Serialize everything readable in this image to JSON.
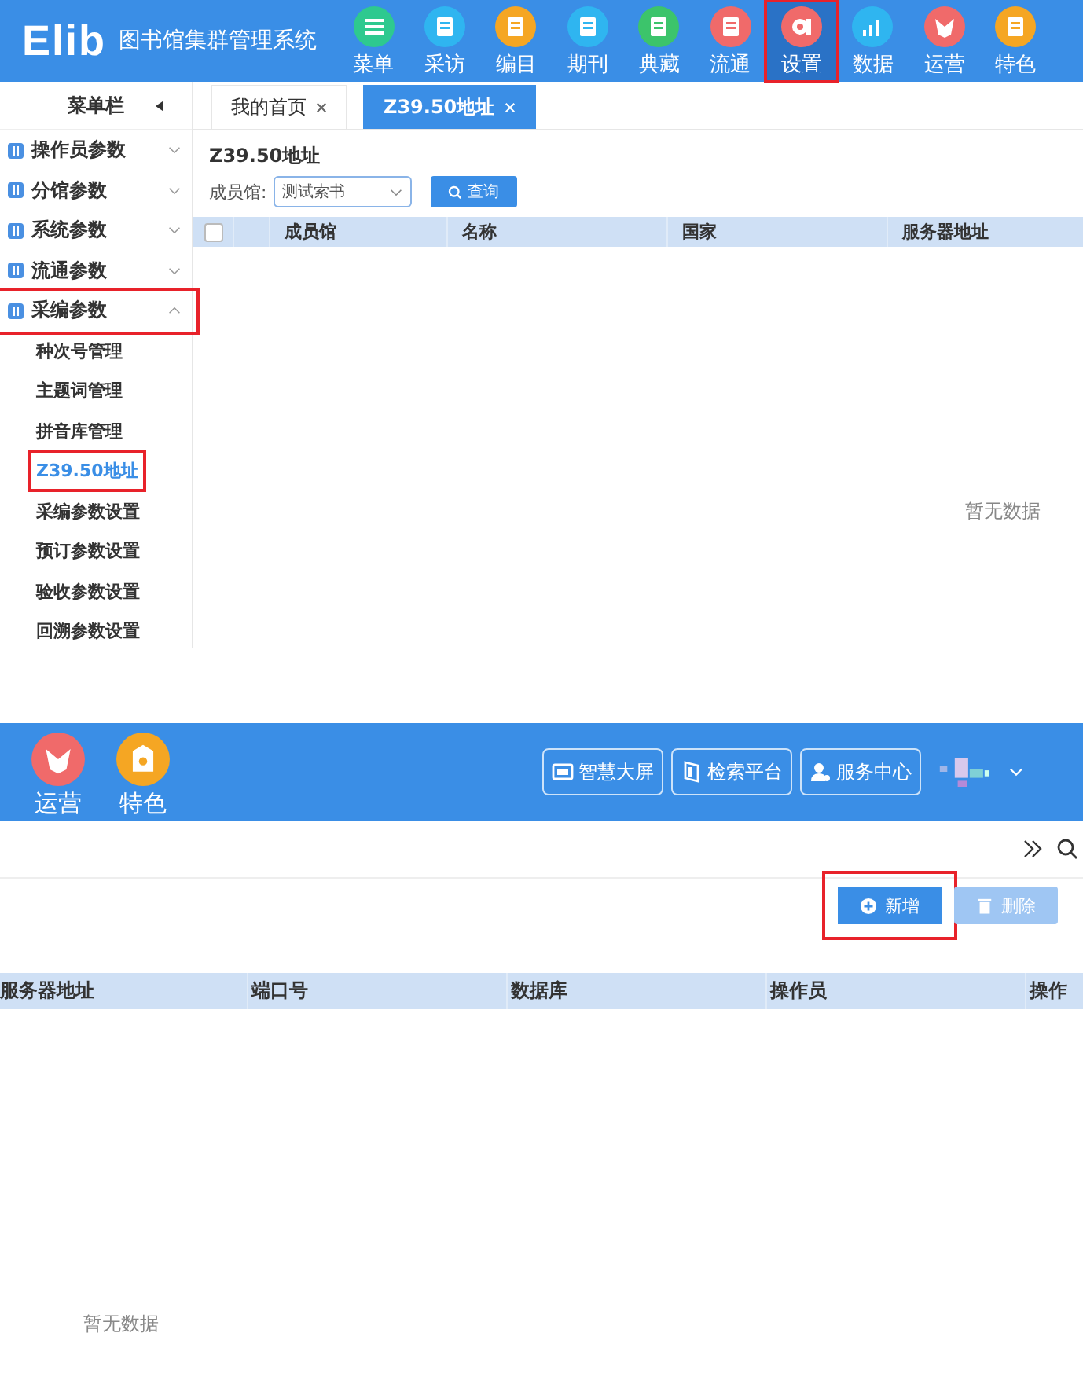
{
  "top_screen": {
    "header": {
      "logo": "Elib",
      "title": "图书馆集群管理系统",
      "nav": [
        {
          "label": "菜单",
          "color": "#2ec98f",
          "selected": false,
          "highlighted": false
        },
        {
          "label": "采访",
          "color": "#2fb5f0",
          "selected": false,
          "highlighted": false
        },
        {
          "label": "编目",
          "color": "#f5a623",
          "selected": false,
          "highlighted": false
        },
        {
          "label": "期刊",
          "color": "#2fb5f0",
          "selected": false,
          "highlighted": false
        },
        {
          "label": "典藏",
          "color": "#3cc46b",
          "selected": false,
          "highlighted": false
        },
        {
          "label": "流通",
          "color": "#f06a6a",
          "selected": false,
          "highlighted": false
        },
        {
          "label": "设置",
          "color": "#f06a6a",
          "selected": true,
          "highlighted": true
        },
        {
          "label": "数据",
          "color": "#2fb5f0",
          "selected": false,
          "highlighted": false
        },
        {
          "label": "运营",
          "color": "#f06a6a",
          "selected": false,
          "highlighted": false
        },
        {
          "label": "特色",
          "color": "#f5a623",
          "selected": false,
          "highlighted": false
        }
      ]
    },
    "sidebar": {
      "title": "菜单栏",
      "groups": [
        {
          "label": "操作员参数",
          "expanded": false,
          "highlighted": false
        },
        {
          "label": "分馆参数",
          "expanded": false,
          "highlighted": false
        },
        {
          "label": "系统参数",
          "expanded": false,
          "highlighted": false
        },
        {
          "label": "流通参数",
          "expanded": false,
          "highlighted": false
        },
        {
          "label": "采编参数",
          "expanded": true,
          "highlighted": true,
          "children": [
            {
              "label": "种次号管理",
              "selected": false,
              "highlighted": false
            },
            {
              "label": "主题词管理",
              "selected": false,
              "highlighted": false
            },
            {
              "label": "拼音库管理",
              "selected": false,
              "highlighted": false
            },
            {
              "label": "Z39.50地址",
              "selected": true,
              "highlighted": true
            },
            {
              "label": "采编参数设置",
              "selected": false,
              "highlighted": false
            },
            {
              "label": "预订参数设置",
              "selected": false,
              "highlighted": false
            },
            {
              "label": "验收参数设置",
              "selected": false,
              "highlighted": false
            },
            {
              "label": "回溯参数设置",
              "selected": false,
              "highlighted": false
            }
          ]
        }
      ]
    },
    "tabs": [
      {
        "label": "我的首页",
        "selected": false
      },
      {
        "label": "Z39.50地址",
        "selected": true
      }
    ],
    "page_title": "Z39.50地址",
    "filter": {
      "label": "成员馆:",
      "value": "测试索书",
      "button": "查询"
    },
    "table": {
      "all_checked": false,
      "columns": [
        "成员馆",
        "名称",
        "国家",
        "服务器地址"
      ],
      "empty_text": "暂无数据"
    }
  },
  "bottom_screen": {
    "nav": [
      {
        "label": "运营",
        "color": "#f06a6a"
      },
      {
        "label": "特色",
        "color": "#f5a623"
      }
    ],
    "header_buttons": [
      "智慧大屏",
      "检索平台",
      "服务中心"
    ],
    "actions": [
      {
        "label": "新增",
        "kind": "add",
        "disabled": false,
        "highlighted": true
      },
      {
        "label": "删除",
        "kind": "delete",
        "disabled": true,
        "highlighted": false
      }
    ],
    "table": {
      "columns": [
        "服务器地址",
        "端口号",
        "数据库",
        "操作员",
        "操作"
      ],
      "empty_text": "暂无数据"
    }
  }
}
